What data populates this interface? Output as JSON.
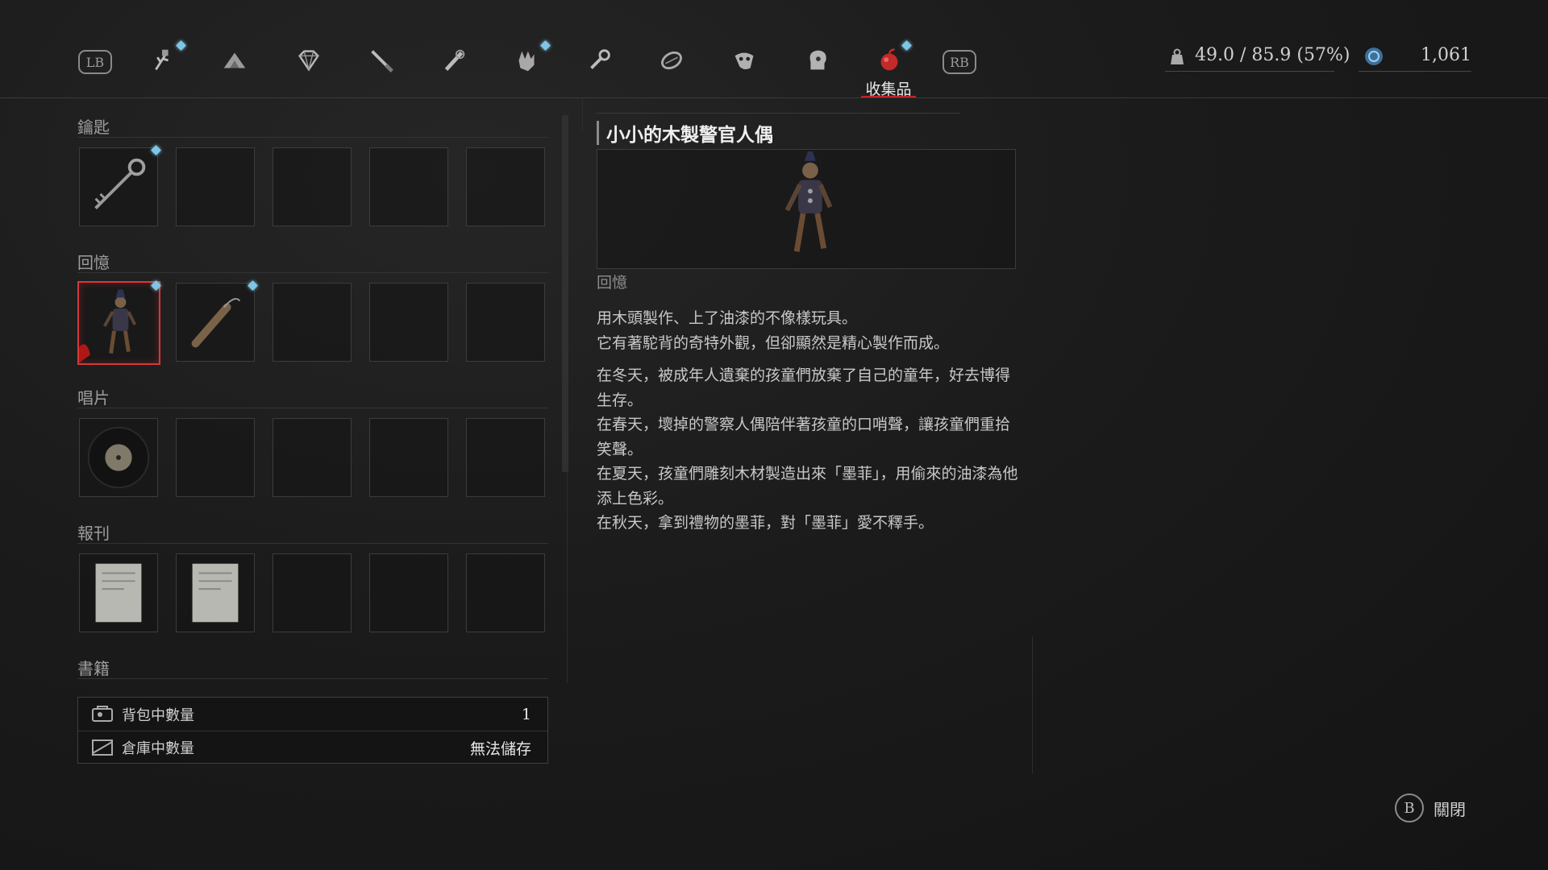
{
  "tabs": {
    "bumper_left": "LB",
    "bumper_right": "RB",
    "items": [
      {
        "icon": "herb-icon",
        "new": true
      },
      {
        "icon": "gunpowder-icon",
        "new": false
      },
      {
        "icon": "gem-icon",
        "new": false
      },
      {
        "icon": "knife-icon",
        "new": false
      },
      {
        "icon": "rifle-scope-icon",
        "new": false
      },
      {
        "icon": "glove-icon",
        "new": true
      },
      {
        "icon": "wrench-icon",
        "new": false
      },
      {
        "icon": "ammo-belt-icon",
        "new": false
      },
      {
        "icon": "mask-icon",
        "new": false
      },
      {
        "icon": "head-profile-icon",
        "new": false
      },
      {
        "icon": "collectible-icon",
        "new": true,
        "active": true
      }
    ],
    "active_label": "收集品"
  },
  "status": {
    "weight": "49.0 / 85.9 (57%)",
    "currency": "1,061"
  },
  "categories": [
    {
      "title": "鑰匙",
      "slots": [
        "key",
        "",
        "",
        "",
        ""
      ],
      "new": [
        true,
        false,
        false,
        false,
        false
      ]
    },
    {
      "title": "回憶",
      "slots": [
        "puppet",
        "whistle",
        "",
        "",
        ""
      ],
      "new": [
        true,
        true,
        false,
        false,
        false
      ]
    },
    {
      "title": "唱片",
      "slots": [
        "record",
        "",
        "",
        "",
        ""
      ],
      "new": [
        false,
        false,
        false,
        false,
        false
      ]
    },
    {
      "title": "報刊",
      "slots": [
        "newspaper",
        "newspaper",
        "",
        "",
        ""
      ],
      "new": [
        false,
        false,
        false,
        false,
        false
      ]
    },
    {
      "title": "書籍",
      "slots": [],
      "new": []
    }
  ],
  "inventory_info": {
    "backpack_label": "背包中數量",
    "backpack_value": "1",
    "storage_label": "倉庫中數量",
    "storage_value": "無法儲存"
  },
  "detail": {
    "title": "小小的木製警官人偶",
    "category": "回憶",
    "paragraphs": [
      [
        "用木頭製作、上了油漆的不像樣玩具。",
        "它有著駝背的奇特外觀，但卻顯然是精心製作而成。"
      ],
      [
        "在冬天，被成年人遺棄的孩童們放棄了自己的童年，好去博得生存。",
        "在春天，壞掉的警察人偶陪伴著孩童的口哨聲，讓孩童們重拾笑聲。",
        "在夏天，孩童們雕刻木材製造出來「墨菲」，用偷來的油漆為他添上色彩。",
        "在秋天，拿到禮物的墨菲，對「墨菲」愛不釋手。"
      ]
    ]
  },
  "close_hint": {
    "button": "B",
    "label": "關閉"
  },
  "colors": {
    "accent_red": "#c0262a",
    "new_marker": "#7fc6e6"
  }
}
